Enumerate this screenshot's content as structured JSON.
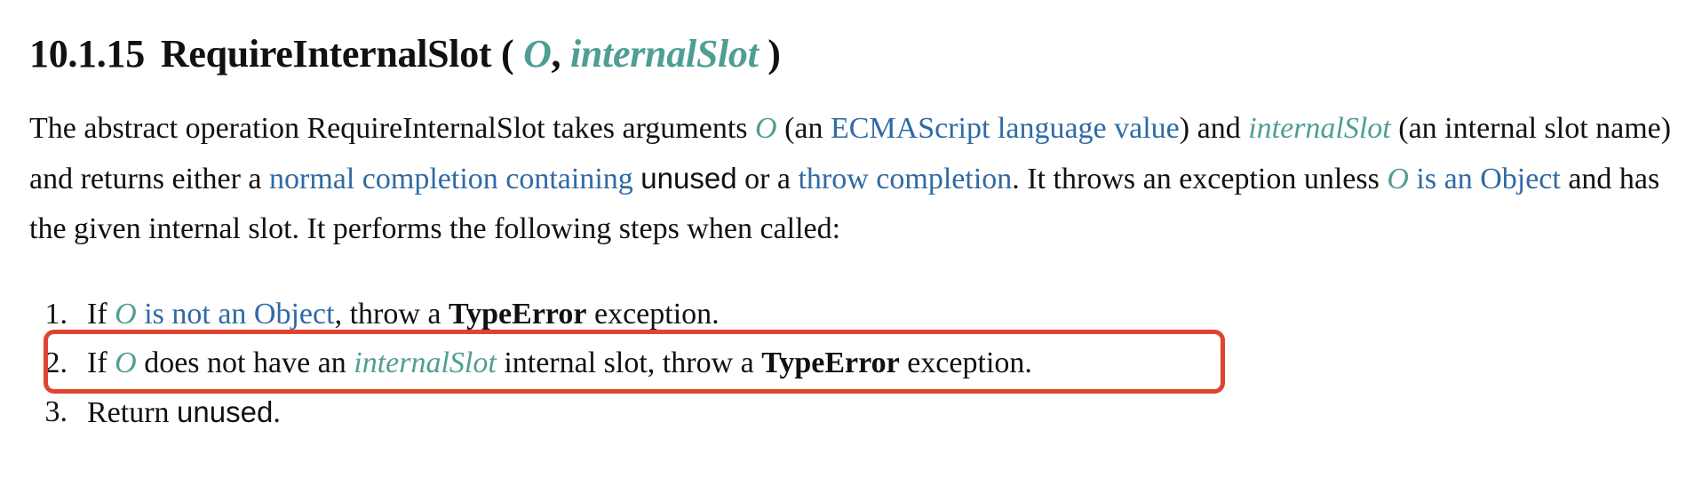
{
  "heading": {
    "number": "10.1.15",
    "name": "RequireInternalSlot",
    "open_paren": "(",
    "param1": "O",
    "comma": ",",
    "param2": "internalSlot",
    "close_paren": ")"
  },
  "intro": {
    "t1": "The abstract operation RequireInternalSlot takes arguments ",
    "o1": "O",
    "t2": " (an ",
    "link1": "ECMAScript language value",
    "t3": ") and ",
    "slot1": "internalSlot",
    "t4": " (an internal slot name) and returns either a ",
    "link2": "normal completion containing",
    "t5": " ",
    "unused": "unused",
    "t6": " or a ",
    "link3": "throw completion",
    "t7": ". It throws an exception unless ",
    "o2": "O",
    "t8": " ",
    "link4": "is an Object",
    "t9": " and has the given internal slot. It performs the following steps when called:"
  },
  "steps": [
    {
      "num": "1",
      "a": "If ",
      "o": "O",
      "b": " ",
      "link": "is not an Object",
      "c": ", throw a ",
      "err": "TypeError",
      "d": " exception."
    },
    {
      "num": "2",
      "a": "If ",
      "o": "O",
      "b": " does not have an ",
      "slot": "internalSlot",
      "c": " internal slot, throw a ",
      "err": "TypeError",
      "d": " exception."
    },
    {
      "num": "3",
      "a": "Return ",
      "unused": "unused",
      "d": "."
    }
  ],
  "colors": {
    "variable": "#4f9e94",
    "link": "#2f6aa6",
    "highlight_border": "#e04431"
  }
}
